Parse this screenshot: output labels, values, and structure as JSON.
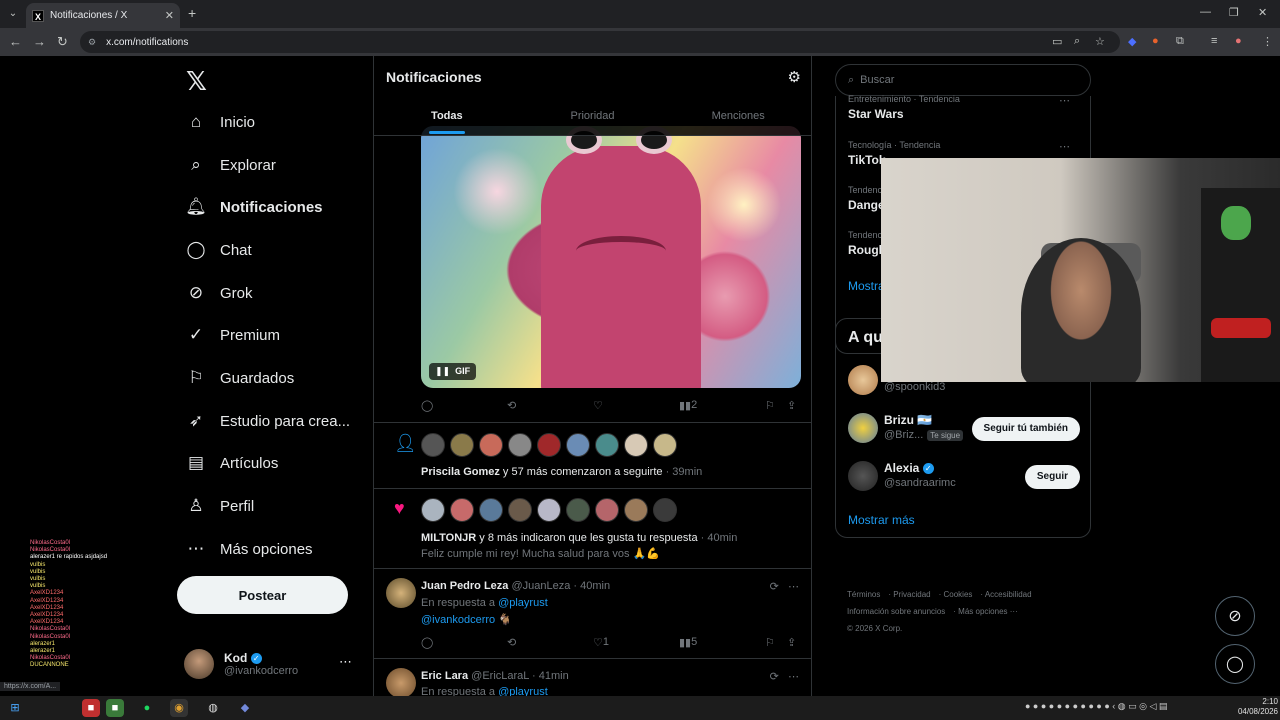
{
  "browser": {
    "tab_title": "Notificaciones / X",
    "url": "x.com/notifications",
    "status_url": "https://x.com/A..."
  },
  "nav": {
    "items": [
      {
        "label": "Inicio",
        "icon": "home-icon"
      },
      {
        "label": "Explorar",
        "icon": "search-icon"
      },
      {
        "label": "Notificaciones",
        "icon": "bell-icon"
      },
      {
        "label": "Chat",
        "icon": "chat-icon"
      },
      {
        "label": "Grok",
        "icon": "grok-icon"
      },
      {
        "label": "Premium",
        "icon": "premium-icon"
      },
      {
        "label": "Guardados",
        "icon": "bookmark-icon"
      },
      {
        "label": "Estudio para crea...",
        "icon": "rocket-icon"
      },
      {
        "label": "Artículos",
        "icon": "article-icon"
      },
      {
        "label": "Perfil",
        "icon": "person-icon"
      },
      {
        "label": "Más opciones",
        "icon": "more-icon"
      }
    ],
    "post_label": "Postear",
    "me": {
      "name": "Kod",
      "handle": "@ivankodcerro"
    }
  },
  "main": {
    "title": "Notificaciones",
    "tabs": [
      "Todas",
      "Prioridad",
      "Menciones"
    ],
    "gif_label": "GIF",
    "gif_actions": {
      "views": "2"
    },
    "follow_notif": {
      "name": "Priscila Gomez",
      "rest": " y 57 más comenzaron a seguirte",
      "time": " · 39min"
    },
    "like_notif": {
      "name": "MILTONJR",
      "rest": " y 8 más indicaron que les gusta tu respuesta",
      "time": " · 40min",
      "text": "Feliz cumple mi rey! Mucha salud para vos 🙏💪"
    },
    "tweet1": {
      "name": "Juan Pedro Leza",
      "handle": "@JuanLeza",
      "time": " · 40min",
      "reply_prefix": "En respuesta a ",
      "reply_to": "@playrust",
      "mention": "@ivankodcerro",
      "mention_emoji": "🐐",
      "likes": "1",
      "views": "5"
    },
    "tweet2": {
      "name": "Eric Lara",
      "handle": "@EricLaraL",
      "time": " · 41min",
      "reply_prefix": "En respuesta a ",
      "reply_to": "@playrust"
    }
  },
  "right": {
    "search_placeholder": "Buscar",
    "trends": [
      {
        "meta": "Entretenimiento · Tendencia",
        "name": "Star Wars"
      },
      {
        "meta": "Tecnología · Tendencia",
        "name": "TikTok"
      },
      {
        "meta": "Tendenc",
        "name": "Dange"
      },
      {
        "meta": "Tendenc",
        "name": "Rough"
      }
    ],
    "show_more_trends": "Mostra",
    "follow_title": "A qu",
    "follow": [
      {
        "name": "",
        "handle": "@spoonkid3",
        "button": ""
      },
      {
        "name": "Brizu 🇦🇷",
        "handle": "@Briz...",
        "badge": "Te sigue",
        "button": "Seguir tú también"
      },
      {
        "name": "Alexia",
        "handle": "@sandraarimc",
        "button": "Seguir"
      }
    ],
    "show_more_follow": "Mostrar más",
    "footer": [
      "Términos",
      "Privacidad",
      "Cookies",
      "Accesibilidad",
      "Información sobre anuncios",
      "Más opciones ···",
      "© 2026 X Corp."
    ]
  },
  "chat_overlay": [
    "NikolasCosta0l",
    "NikolasCosta0l",
    "alerazer1 re rapidos asjdajsd",
    "vulbis",
    "vulbis",
    "vulbis",
    "vulbis",
    "AxelXD1234",
    "AxelXD1234",
    "AxelXD1234",
    "AxelXD1234",
    "AxelXD1234",
    "NikolasCosta0l",
    "NikolasCosta0l",
    "alerazer1",
    "alerazer1",
    "NikolasCosta0l",
    "DUCANNONE"
  ],
  "taskbar": {
    "time": "2:10",
    "date": "04/08/2026"
  },
  "colors": {
    "accent": "#1d9bf0",
    "like": "#f91880"
  }
}
